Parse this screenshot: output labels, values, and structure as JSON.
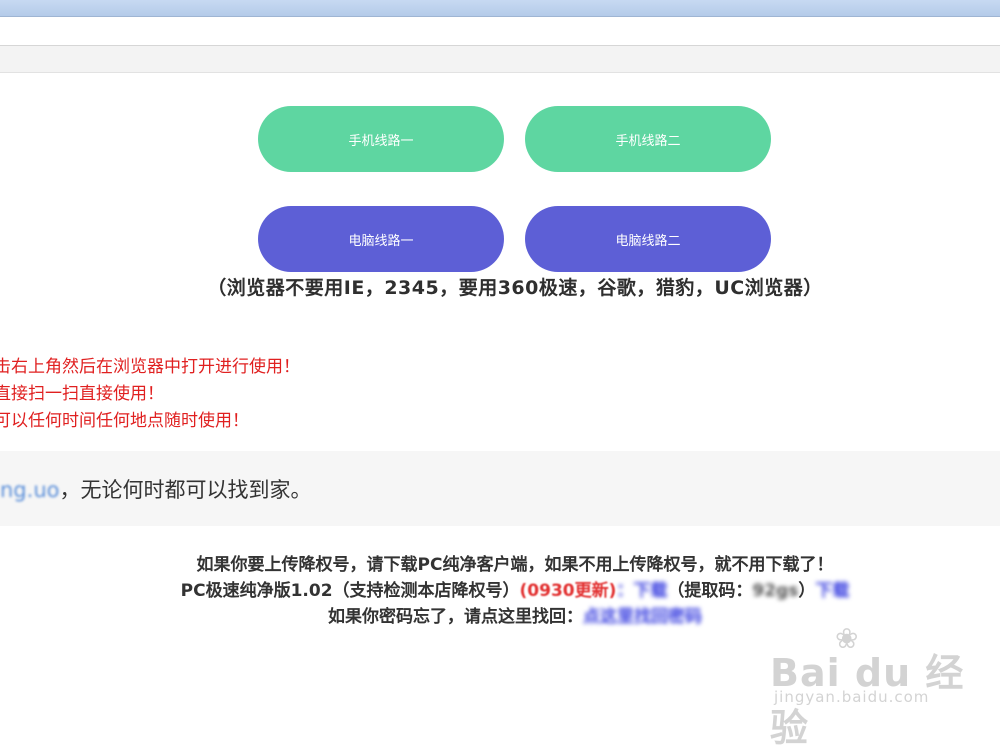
{
  "buttons": {
    "mobile_line_1": "手机线路一",
    "mobile_line_2": "手机线路二",
    "pc_line_1": "电脑线路一",
    "pc_line_2": "电脑线路二"
  },
  "browser_note": "（浏览器不要用IE，2345，要用360极速，谷歌，猎豹，UC浏览器）",
  "instructions": [
    "击右上角然后在浏览器中打开进行使用！",
    "直接扫一扫直接使用！",
    "可以任何时间任何地点随时使用！"
  ],
  "domain_line": {
    "link_text": "ng.uo",
    "suffix": "，无论何时都可以找到家。"
  },
  "bottom": {
    "line1": "如果你要上传降权号，请下载PC纯净客户端，如果不用上传降权号，就不用下载了！",
    "line2_prefix": "PC极速纯净版1.02（支持检测本店降权号）",
    "line2_red": "(0930更新)",
    "line2_blur1": "：下载",
    "line2_code_label": "（提取码：",
    "line2_code": "92gs",
    "line2_close": "）",
    "line2_blur2": "下载",
    "line3_prefix": "如果你密码忘了，请点这里找回：",
    "line3_link": "点这里找回密码"
  },
  "watermark": {
    "brand": "Bai du 经验",
    "sub": "jingyan.baidu.com"
  }
}
